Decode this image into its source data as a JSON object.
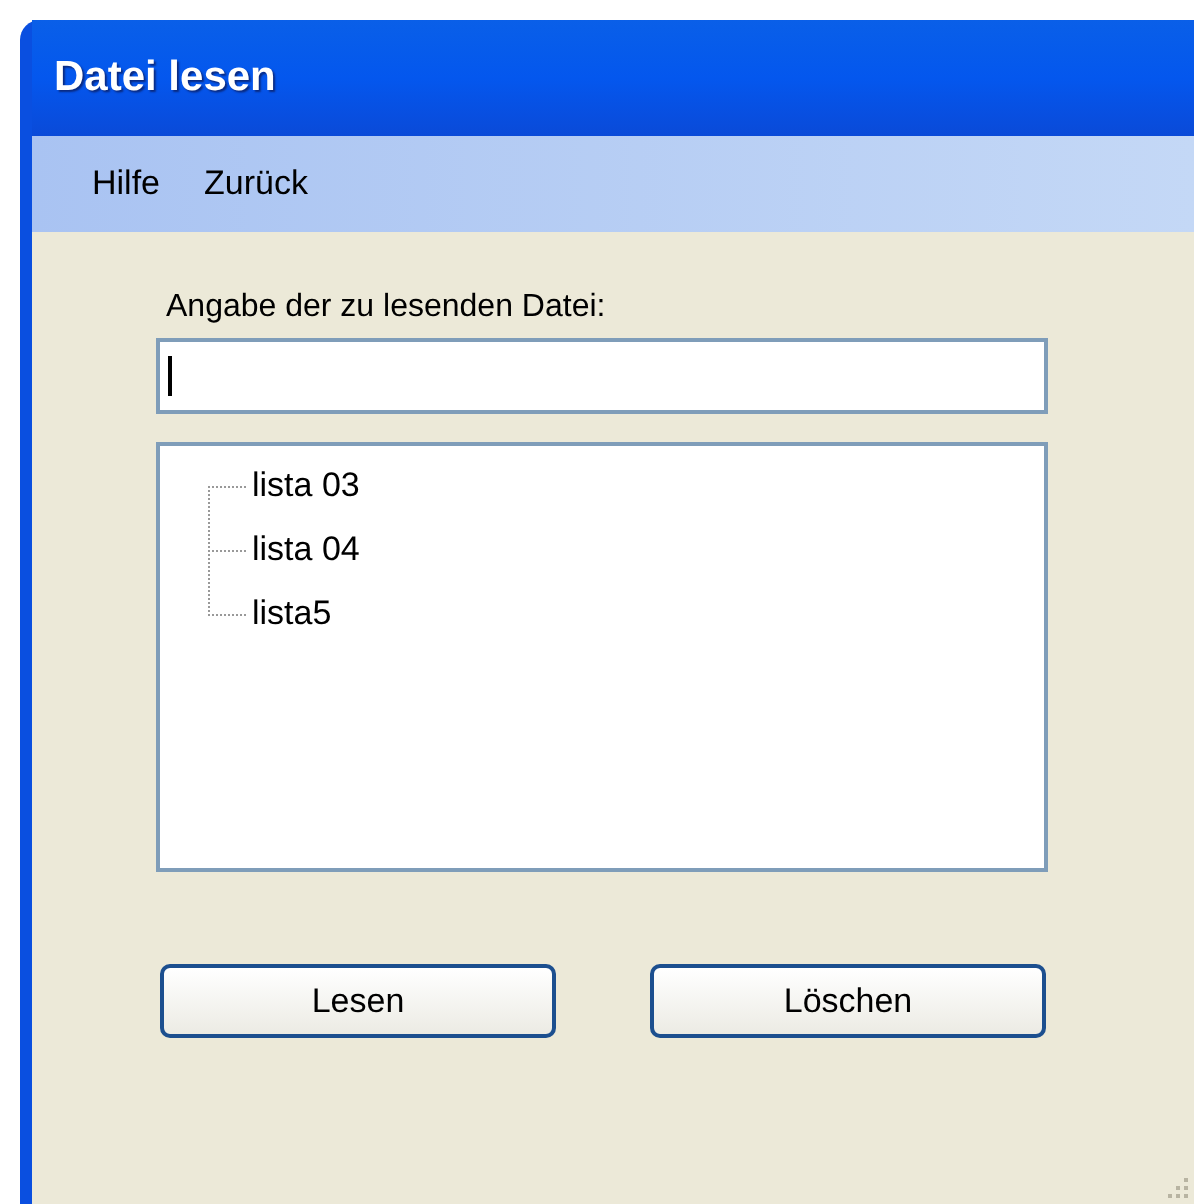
{
  "window": {
    "title": "Datei lesen"
  },
  "menu": [
    "Hilfe",
    "Zurück"
  ],
  "file_field": {
    "label": "Angabe der zu lesenden Datei:"
  },
  "tree": {
    "items": [
      {
        "label": "lista 03"
      },
      {
        "label": "lista 04"
      },
      {
        "label": "lista5"
      }
    ]
  },
  "buttons": [
    "Lesen",
    "Löschen"
  ]
}
